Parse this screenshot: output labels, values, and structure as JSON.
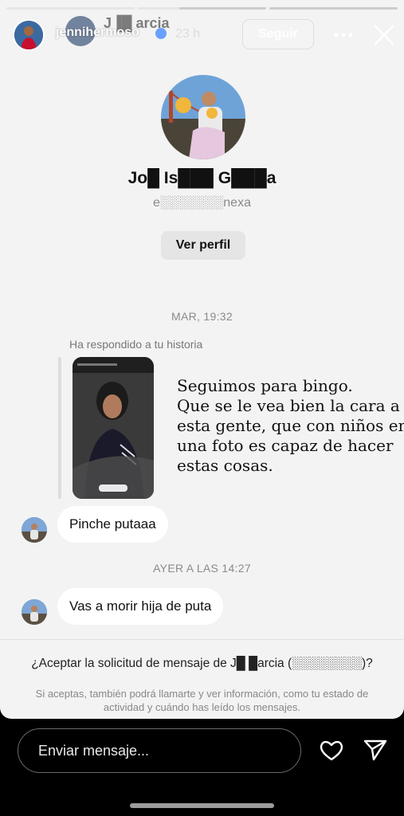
{
  "story": {
    "username": "jennihermoso",
    "time_ago": "23 h",
    "follow_label": "Seguir"
  },
  "dm": {
    "header_name": "J▐█       arcia",
    "profile_name": "Jo█ Is███ G███a",
    "profile_handle": "e░░░░░░░nexa",
    "view_profile_label": "Ver perfil",
    "timestamp_1": "MAR, 19:32",
    "reply_label": "Ha respondido a tu historia",
    "story_caption": [
      "Seguimos para bingo.",
      "Que se le vea bien la cara a",
      "esta gente, que con niños en",
      "una foto es capaz de hacer",
      "estas cosas."
    ],
    "message_1": "Pinche putaaa",
    "timestamp_2": "AYER A LAS 14:27",
    "message_2": "Vas a morir hija de puta",
    "request_title": "¿Aceptar la solicitud de mensaje de J█      █arcia (░░░░░░░░)?",
    "request_note": "Si aceptas, también podrá llamarte y ver información, como tu estado de actividad y cuándo has leído los mensajes."
  },
  "reply_bar": {
    "placeholder": "Enviar mensaje..."
  },
  "icons": {
    "more": "more-icon",
    "close": "close-icon",
    "heart": "heart-icon",
    "share": "share-icon"
  },
  "colors": {
    "story_background": "#f3f3f3",
    "bubble": "#ffffff",
    "bottom_bar": "#000000"
  }
}
